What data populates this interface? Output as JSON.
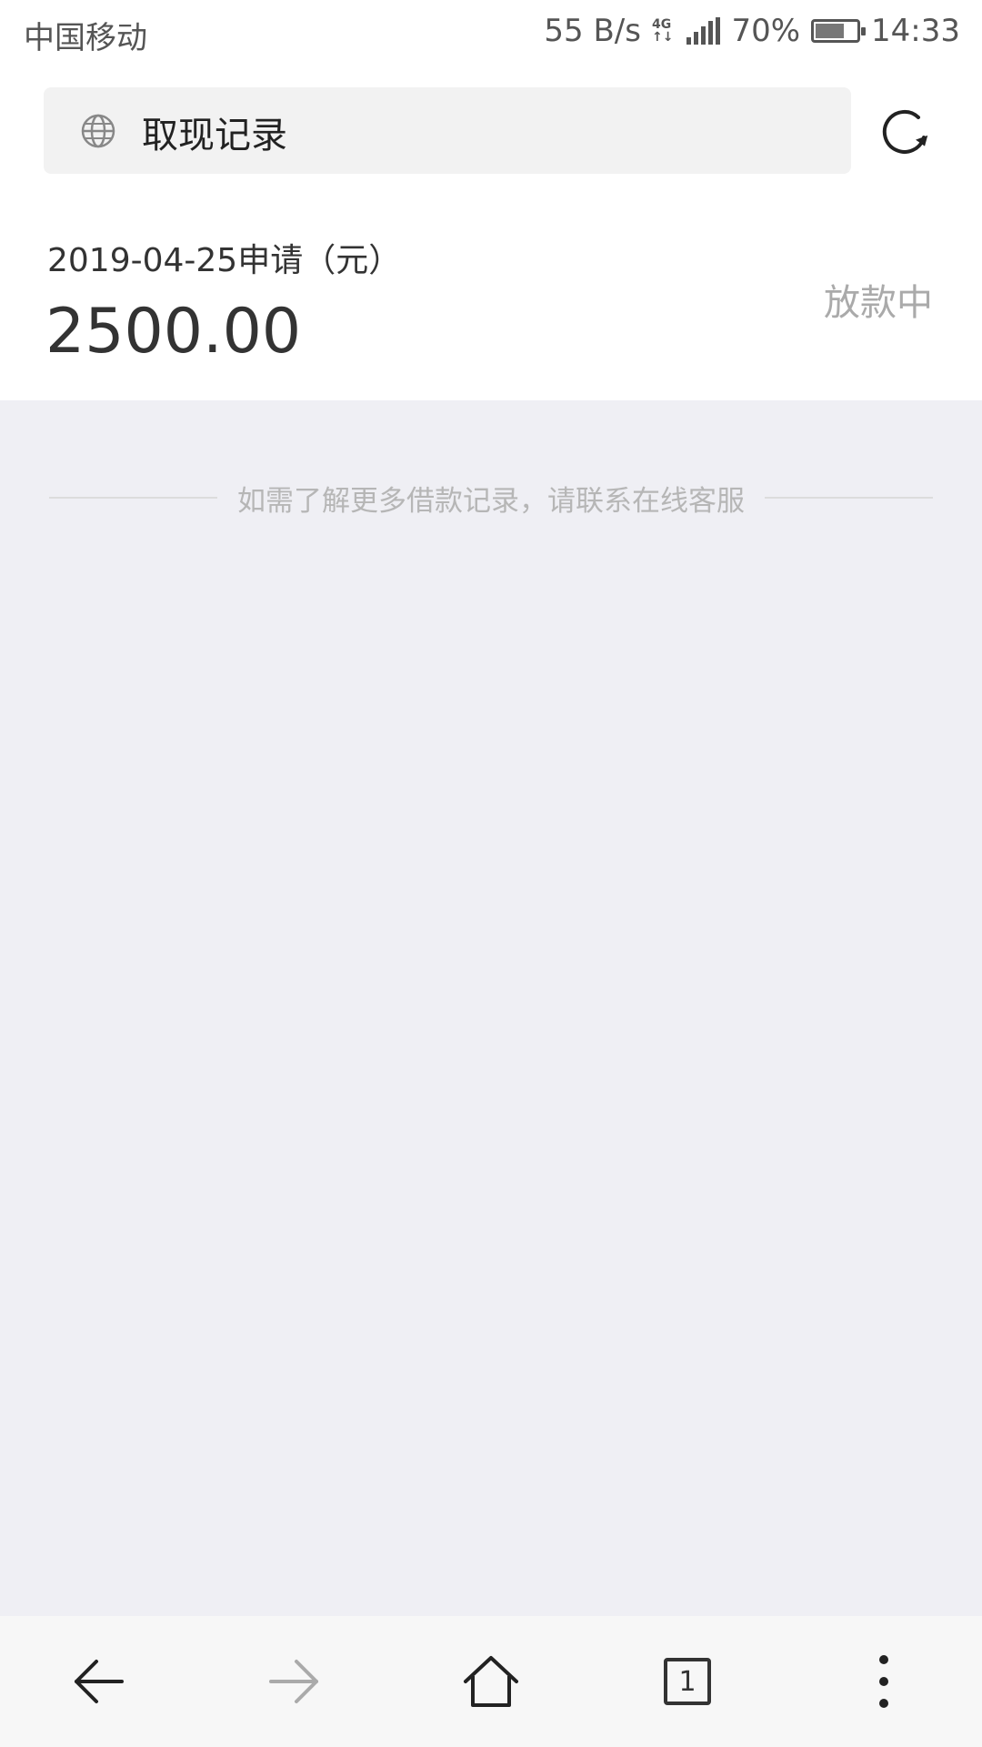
{
  "status_bar": {
    "carrier": "中国移动",
    "net_speed": "55 B/s",
    "net_type_top": "4G",
    "net_type_bottom": "↑↓",
    "battery": "70%",
    "battery_level": 0.7,
    "time": "14:33"
  },
  "address_bar": {
    "title": "取现记录"
  },
  "record": {
    "date_label": "2019-04-25申请（元）",
    "amount": "2500.00",
    "status": "放款中"
  },
  "info": {
    "text": "如需了解更多借款记录，请联系在线客服"
  },
  "bottom_nav": {
    "tab_count": "1"
  },
  "colors": {
    "page_bg": "#efeff4",
    "status_gray": "#aaaaaa",
    "text_dark": "#333333"
  }
}
